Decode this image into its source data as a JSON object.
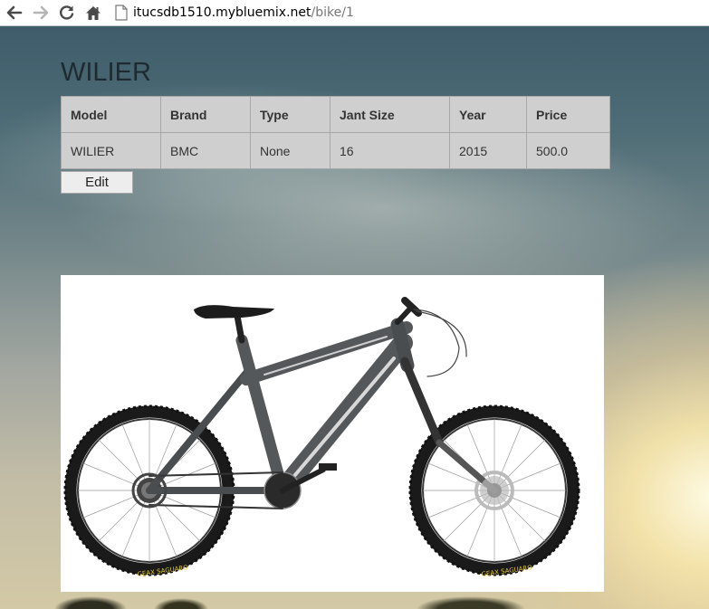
{
  "browser": {
    "url_host": "itucsdb1510.mybluemix.net",
    "url_path": "/bike/1"
  },
  "page": {
    "title": "WILIER"
  },
  "table": {
    "headers": [
      "Model",
      "Brand",
      "Type",
      "Jant Size",
      "Year",
      "Price"
    ],
    "row": [
      "WILIER",
      "BMC",
      "None",
      "16",
      "2015",
      "500.0"
    ]
  },
  "actions": {
    "edit_label": "Edit"
  },
  "image": {
    "tire_brand_text": "GEAX SAGUARO"
  },
  "colors": {
    "table_bg": "#cfcfcf",
    "bike_frame": "#55585a",
    "bike_accent": "#d8d8d8"
  }
}
